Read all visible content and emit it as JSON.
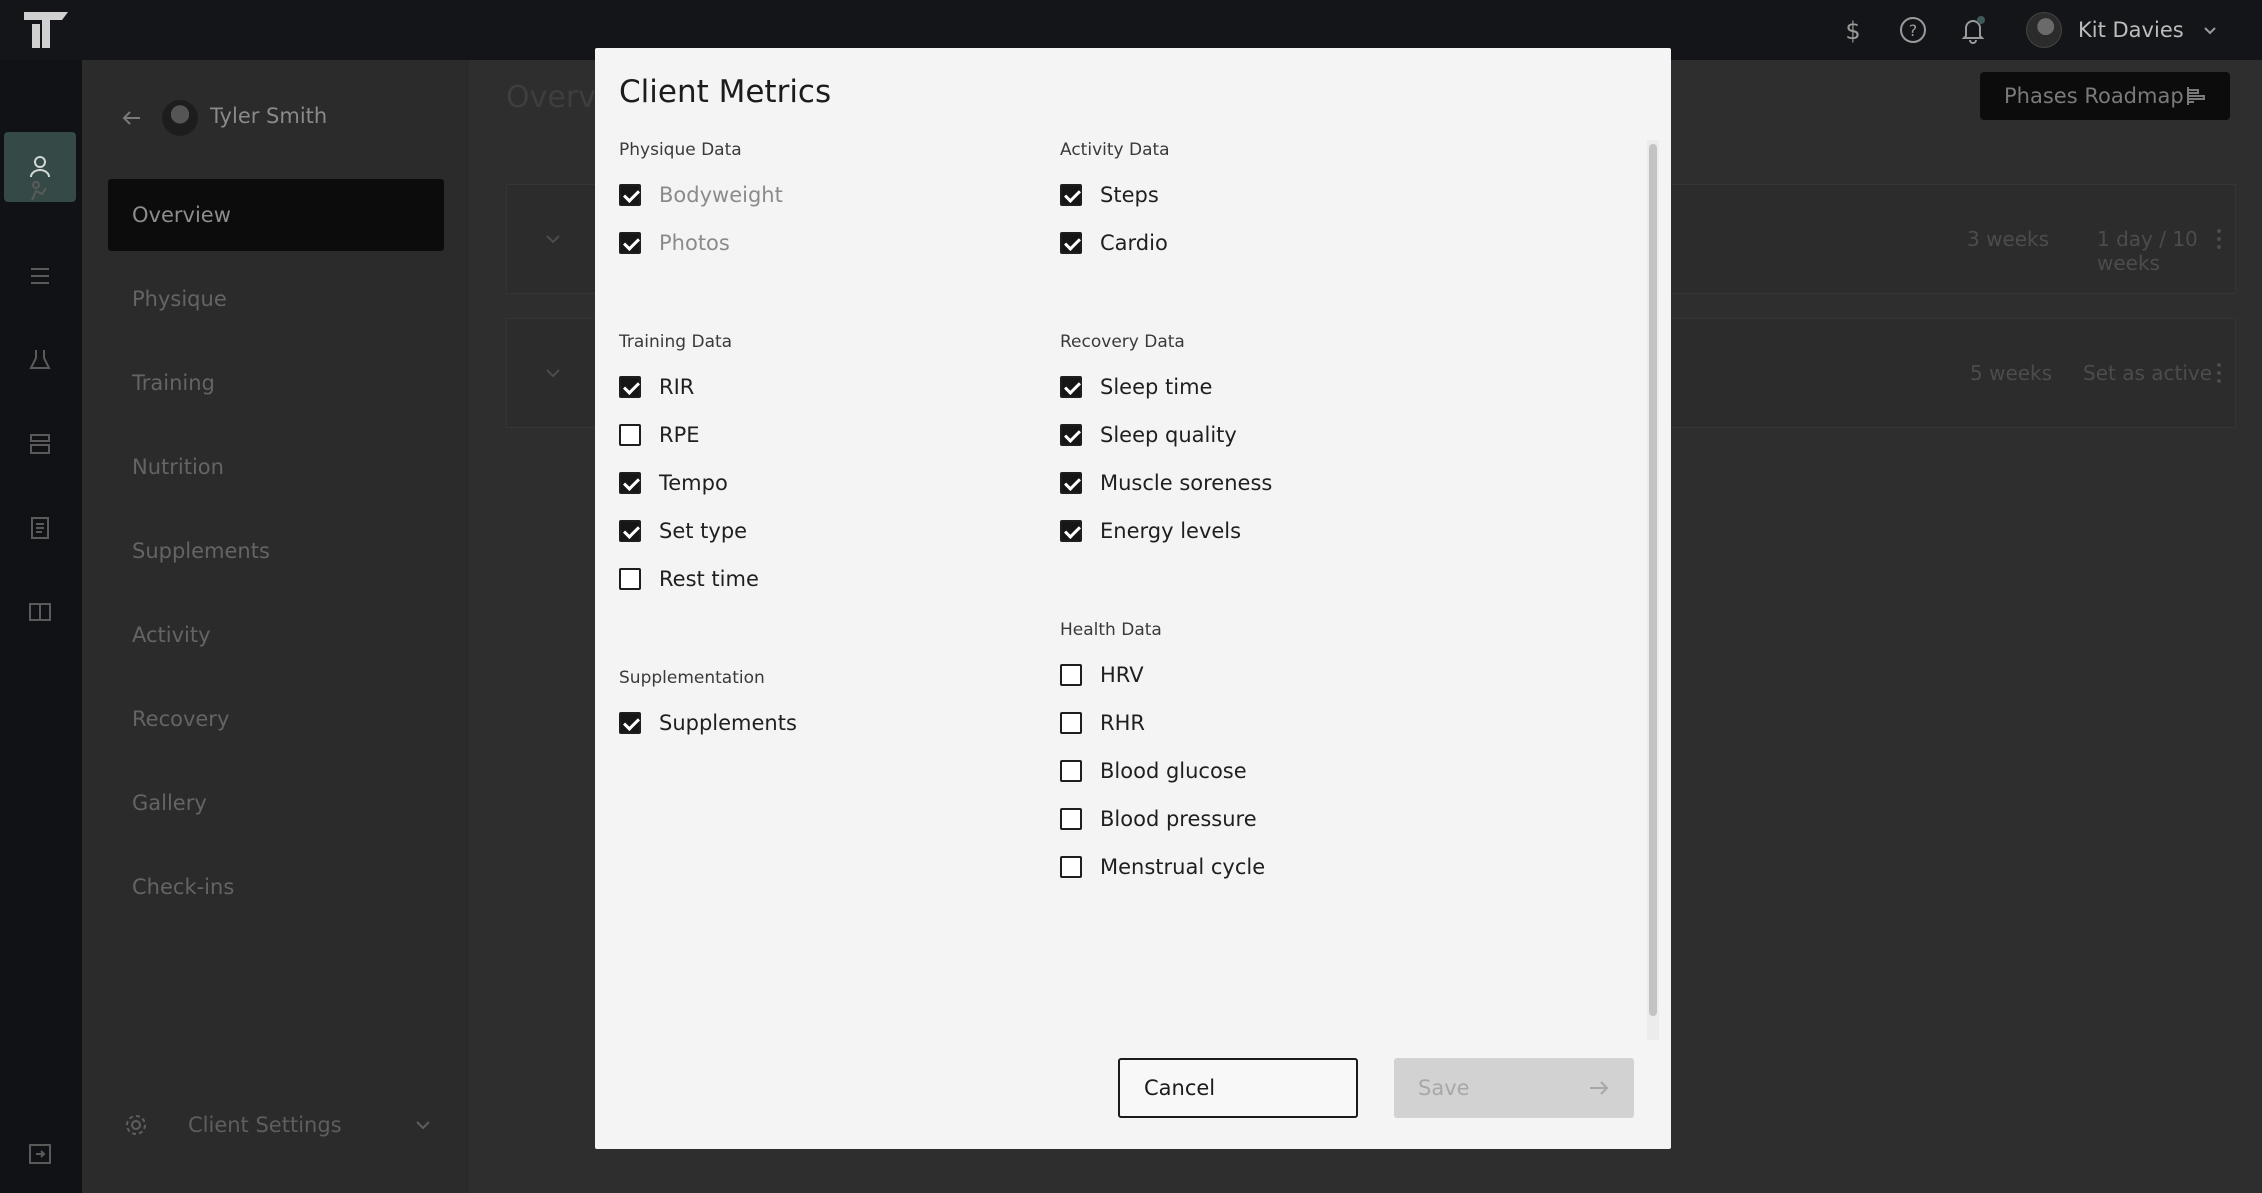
{
  "topbar": {
    "user_name": "Kit Davies"
  },
  "sidebar": {
    "client_name": "Tyler Smith",
    "items": [
      {
        "label": "Overview",
        "active": true
      },
      {
        "label": "Physique",
        "active": false
      },
      {
        "label": "Training",
        "active": false
      },
      {
        "label": "Nutrition",
        "active": false
      },
      {
        "label": "Supplements",
        "active": false
      },
      {
        "label": "Activity",
        "active": false
      },
      {
        "label": "Recovery",
        "active": false
      },
      {
        "label": "Gallery",
        "active": false
      },
      {
        "label": "Check-ins",
        "active": false
      }
    ],
    "client_settings_label": "Client Settings"
  },
  "main": {
    "page_title": "Overvi",
    "roadmap_button": "Phases Roadmap",
    "phases": [
      {
        "duration": "3 weeks",
        "progress": "1 day / 10 weeks"
      },
      {
        "duration": "5 weeks",
        "action": "Set as active"
      }
    ]
  },
  "modal": {
    "title": "Client Metrics",
    "sections": {
      "physique": {
        "title": "Physique Data",
        "items": [
          {
            "label": "Bodyweight",
            "checked": true,
            "disabled": true
          },
          {
            "label": "Photos",
            "checked": true,
            "disabled": true
          }
        ]
      },
      "training": {
        "title": "Training Data",
        "items": [
          {
            "label": "RIR",
            "checked": true
          },
          {
            "label": "RPE",
            "checked": false
          },
          {
            "label": "Tempo",
            "checked": true
          },
          {
            "label": "Set type",
            "checked": true
          },
          {
            "label": "Rest time",
            "checked": false
          }
        ]
      },
      "supplementation": {
        "title": "Supplementation",
        "items": [
          {
            "label": "Supplements",
            "checked": true
          }
        ]
      },
      "activity": {
        "title": "Activity Data",
        "items": [
          {
            "label": "Steps",
            "checked": true
          },
          {
            "label": "Cardio",
            "checked": true
          }
        ]
      },
      "recovery": {
        "title": "Recovery Data",
        "items": [
          {
            "label": "Sleep time",
            "checked": true
          },
          {
            "label": "Sleep quality",
            "checked": true
          },
          {
            "label": "Muscle soreness",
            "checked": true
          },
          {
            "label": "Energy levels",
            "checked": true
          }
        ]
      },
      "health": {
        "title": "Health Data",
        "items": [
          {
            "label": "HRV",
            "checked": false
          },
          {
            "label": "RHR",
            "checked": false
          },
          {
            "label": "Blood glucose",
            "checked": false
          },
          {
            "label": "Blood pressure",
            "checked": false
          },
          {
            "label": "Menstrual cycle",
            "checked": false
          }
        ]
      }
    },
    "cancel_label": "Cancel",
    "save_label": "Save"
  },
  "colors": {
    "overlay_bg": "#2e2e2e",
    "modal_bg": "#f4f4f4",
    "accent_teal": "#354a47"
  }
}
